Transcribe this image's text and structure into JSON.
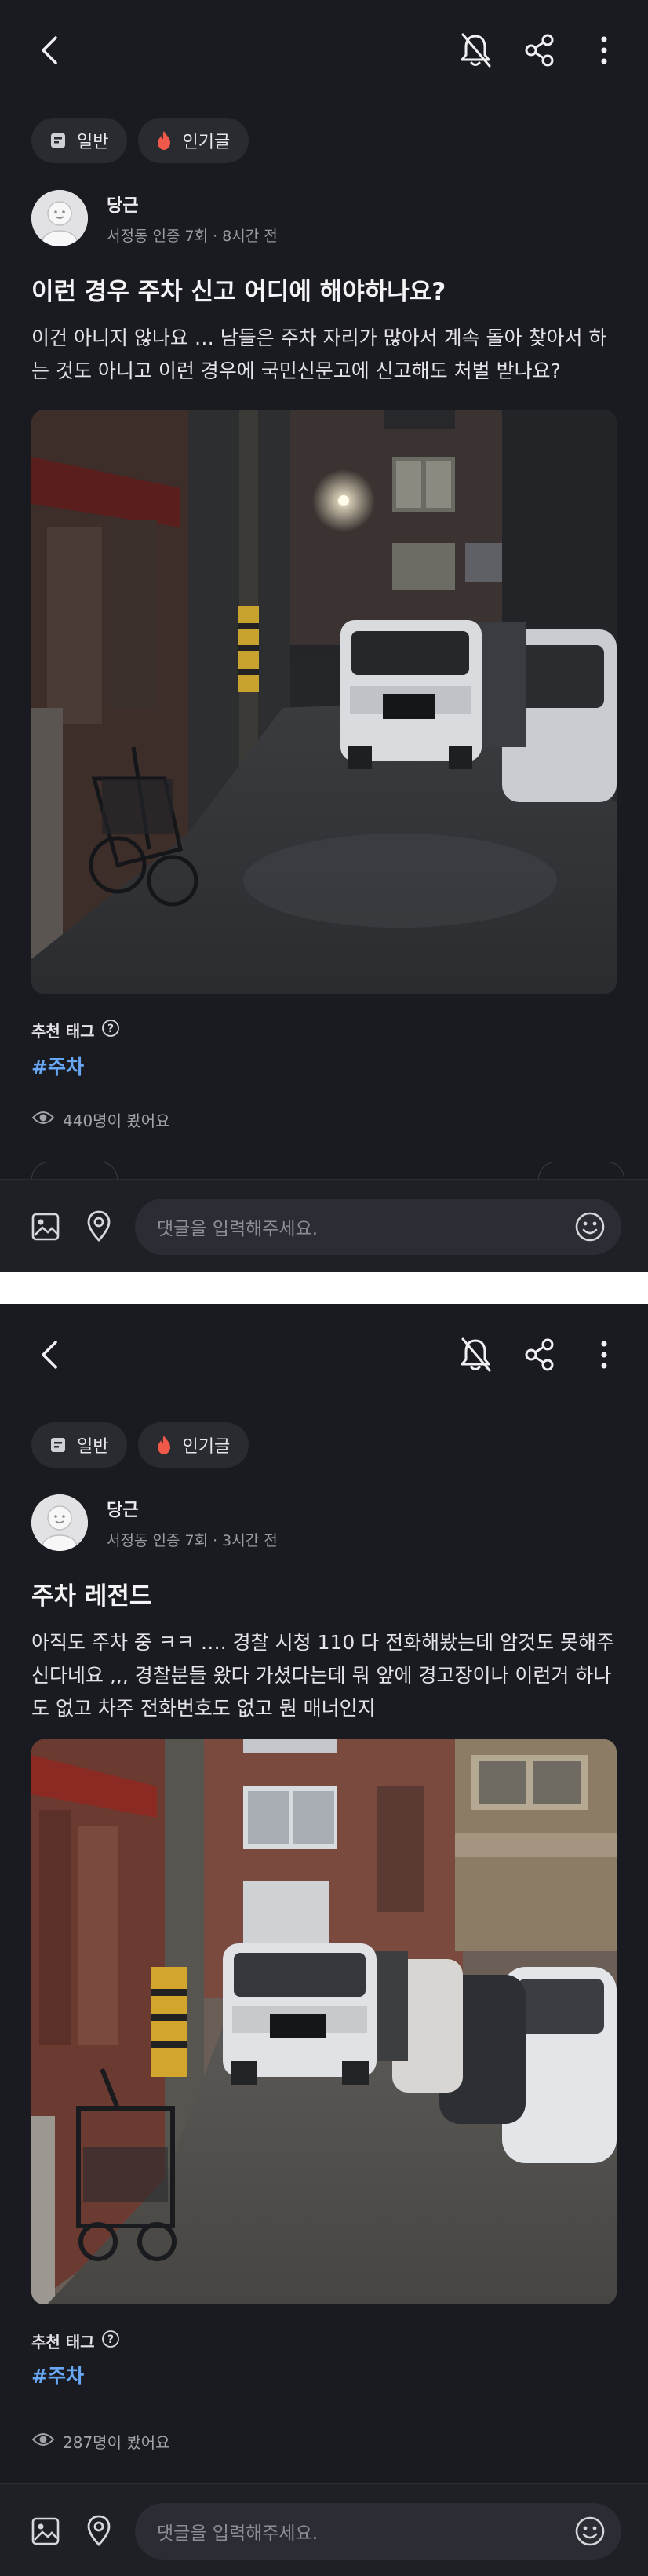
{
  "composer": {
    "placeholder": "댓글을 입력해주세요."
  },
  "posts": [
    {
      "chips": {
        "general": "일반",
        "popular": "인기글"
      },
      "author": {
        "name": "당근",
        "meta": "서정동 인증 7회 · 8시간 전"
      },
      "title": "이런 경우 주차 신고 어디에 해야하나요?",
      "body": [
        "이건 아니지 않나요 … 남들은 주차 자리가 많아서 계속 돌아 찾아서 하",
        "는 것도 아니고 이런 경우에 국민신문고에 신고해도 처벌 받나요?"
      ],
      "recommended_label": "추천 태그",
      "tag": "#주차",
      "views": "440명이 봤어요"
    },
    {
      "chips": {
        "general": "일반",
        "popular": "인기글"
      },
      "author": {
        "name": "당근",
        "meta": "서정동 인증 7회 · 3시간 전"
      },
      "title": "주차 레전드",
      "body": [
        "아직도 주차 중 ㅋㅋ …. 경찰 시청 110 다 전화해봤는데 암것도 못해주",
        "신다네요 ,,, 경찰분들 왔다 가셨다는데 뭐 앞에 경고장이나 이런거 하나",
        "도 없고 차주 전화번호도 없고 뭔 매너인지"
      ],
      "recommended_label": "추천 태그",
      "tag": "#주차",
      "views": "287명이 봤어요"
    }
  ],
  "colors": {
    "background": "#1a1b21",
    "chip": "#2a2b31",
    "tag": "#67a7f3",
    "popular_flame": "#f0584a"
  },
  "icons": [
    "back-arrow-icon",
    "notification-off-icon",
    "share-icon",
    "more-vertical-icon",
    "document-icon",
    "flame-icon",
    "help-circle-icon",
    "eye-icon",
    "image-icon",
    "location-pin-icon",
    "emoji-icon"
  ]
}
